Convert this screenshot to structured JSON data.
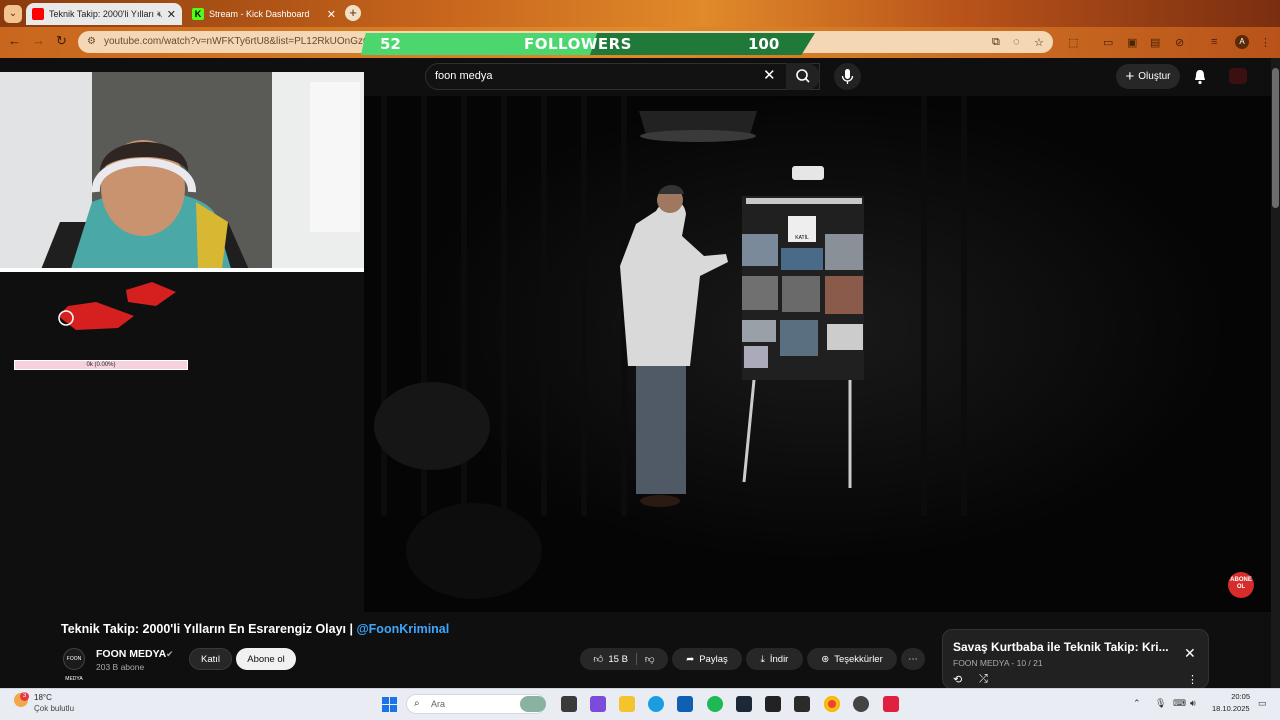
{
  "browser": {
    "tabs": [
      {
        "label": "Teknik Takip: 2000'li Yılların",
        "active": true
      },
      {
        "label": "Stream - Kick Dashboard",
        "active": false
      }
    ],
    "url": "youtube.com/watch?v=nWFKTy6rtU8&list=PL12RkUOnGz67",
    "profile_initial": "A"
  },
  "stream_overlay": {
    "followers_current": "52",
    "followers_label": "FOLLOWERS",
    "followers_goal": "100",
    "followers_progress": 0.52,
    "progress_bar_text": "0k (0.00%)"
  },
  "youtube": {
    "search_value": "foon medya",
    "create_label": "Oluştur",
    "video_title": "Teknik Takip: 2000'li Yılların En Esrarengiz Olayı | ",
    "video_title_handle": "@FoonKriminal",
    "channel_logo_text": "FOON MEDYA",
    "channel_name": "FOON MEDYA",
    "subscriber_count": "203 B abone",
    "join_label": "Katıl",
    "subscribe_label": "Abone ol",
    "like_count": "15 B",
    "share_label": "Paylaş",
    "download_label": "İndir",
    "thanks_label": "Teşekkürler",
    "abone_badge": "ABONE OL",
    "playlist": {
      "title": "Savaş Kurtbaba ile Teknik Takip: Kri...",
      "meta": "FOON MEDYA - 10 / 21"
    },
    "board_label": "KATİL"
  },
  "taskbar": {
    "weather_temp": "18°C",
    "weather_cond": "Çok bulutlu",
    "weather_badge": "3",
    "search_placeholder": "Ara",
    "time": "20:05",
    "date": "18.10.2025"
  }
}
